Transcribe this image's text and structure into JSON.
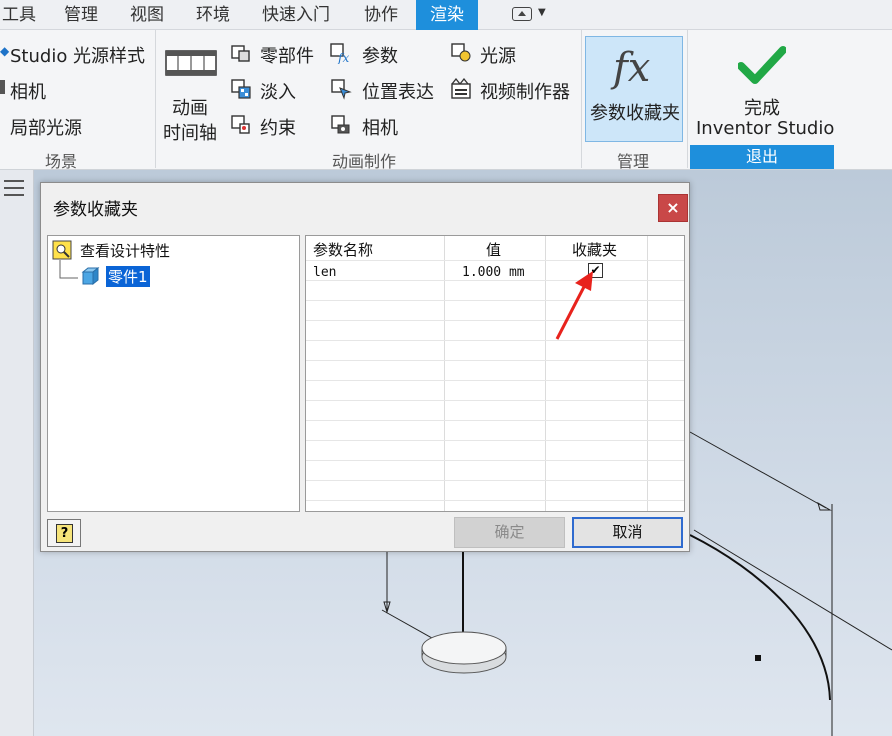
{
  "menu": {
    "tabs": [
      "工具",
      "管理",
      "视图",
      "环境",
      "快速入门",
      "协作",
      "渲染"
    ],
    "active_tab": "渲染"
  },
  "ribbon": {
    "scene_group": {
      "items": [
        "Studio 光源样式",
        "相机",
        "局部光源"
      ],
      "label": "场景"
    },
    "animation_group": {
      "timeline_line1": "动画",
      "timeline_line2": "时间轴",
      "col1": [
        "零部件",
        "淡入",
        "约束"
      ],
      "col2": [
        "参数",
        "位置表达",
        "相机"
      ],
      "col3": [
        "光源",
        "视频制作器"
      ],
      "label": "动画制作"
    },
    "manage_group": {
      "button_label": "参数收藏夹",
      "label": "管理"
    },
    "exit_group": {
      "line1": "完成",
      "line2": "Inventor Studio",
      "label": "退出"
    }
  },
  "dialog": {
    "title": "参数收藏夹",
    "close_label": "×",
    "tree": {
      "root_label": "查看设计特性",
      "child_label": "零件1"
    },
    "table": {
      "headers": [
        "参数名称",
        "值",
        "收藏夹"
      ],
      "rows": [
        {
          "name": "len",
          "value": "1.000 mm",
          "favorite": true
        }
      ]
    },
    "help_label": "?",
    "ok_label": "确定",
    "cancel_label": "取消"
  },
  "colors": {
    "accent": "#1e8fdc",
    "selection": "#0a64d6",
    "close_button": "#c94848",
    "annotation_arrow": "#e8221c"
  }
}
